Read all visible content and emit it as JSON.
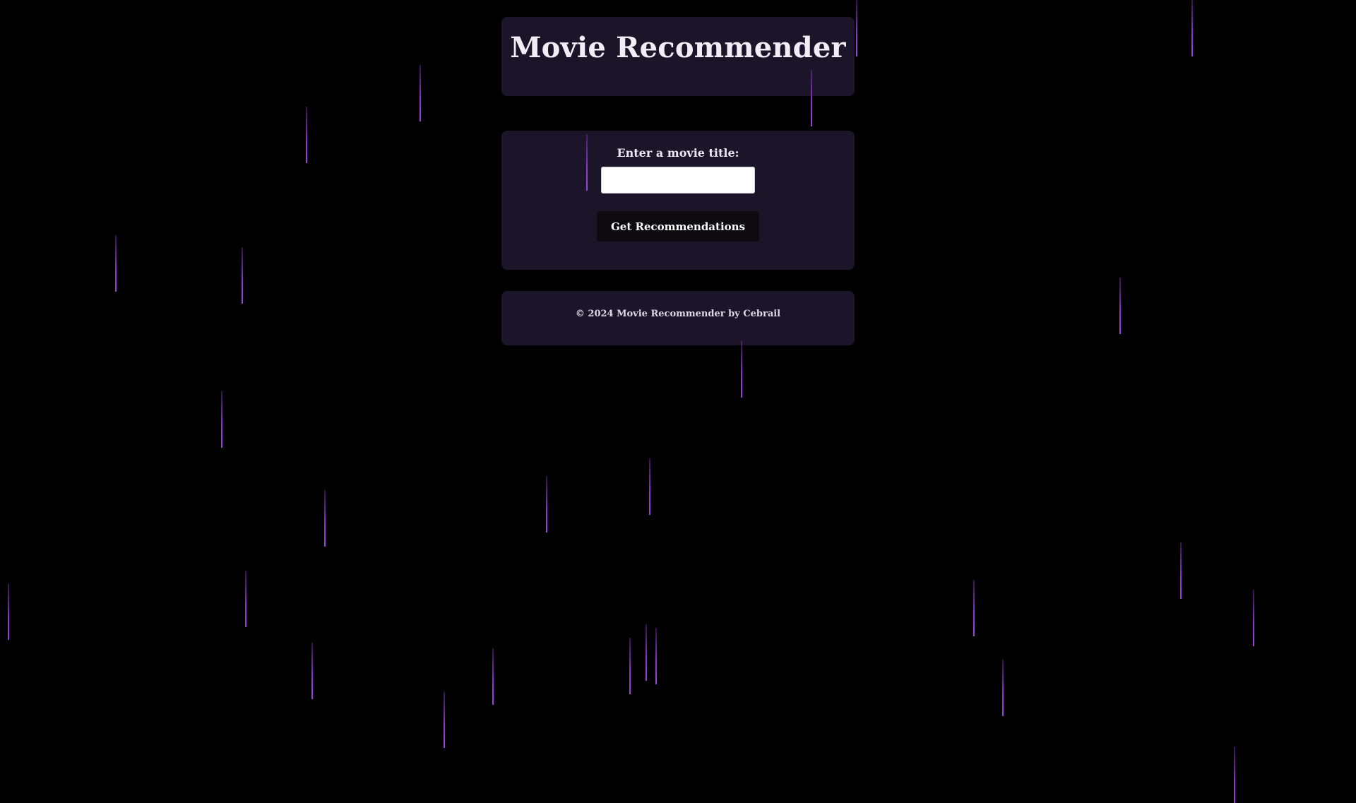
{
  "header": {
    "title": "Movie Recommender"
  },
  "form": {
    "label": "Enter a movie title:",
    "input_value": "",
    "input_placeholder": "",
    "button_label": "Get Recommendations"
  },
  "footer": {
    "text": "© 2024 Movie Recommender by Cebrail"
  },
  "colors": {
    "background": "#000000",
    "panel": "#1c1428",
    "rain": "#9b3ce6",
    "button": "#0d0b10"
  }
}
